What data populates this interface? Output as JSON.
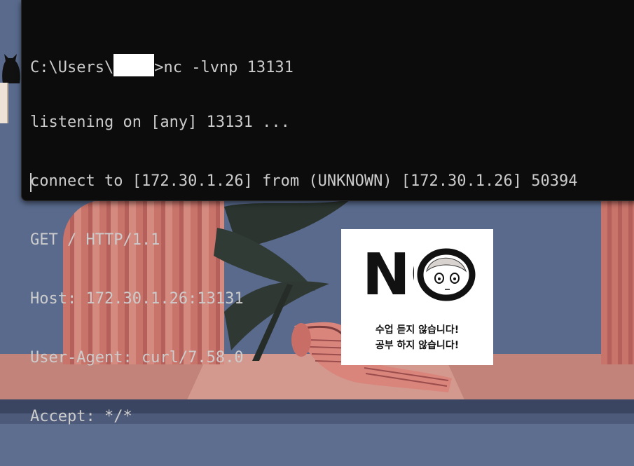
{
  "terminal": {
    "prompt_prefix": "C:\\Users\\",
    "prompt_suffix": ">nc -lvnp 13131",
    "lines": [
      "listening on [any] 13131 ...",
      "connect to [172.30.1.26] from (UNKNOWN) [172.30.1.26] 50394",
      "GET / HTTP/1.1",
      "Host: 172.30.1.26:13131",
      "User-Agent: curl/7.58.0",
      "Accept: */*"
    ]
  },
  "wallpaper": {
    "sign": {
      "big_text": "NO",
      "line1": "수업 듣지 않습니다!",
      "line2": "공부 하지 않습니다!"
    }
  },
  "colors": {
    "terminal_bg": "#0c0c0c",
    "terminal_text": "#cccccc",
    "wall": "#596a8c",
    "curtain": "#c8746a"
  }
}
